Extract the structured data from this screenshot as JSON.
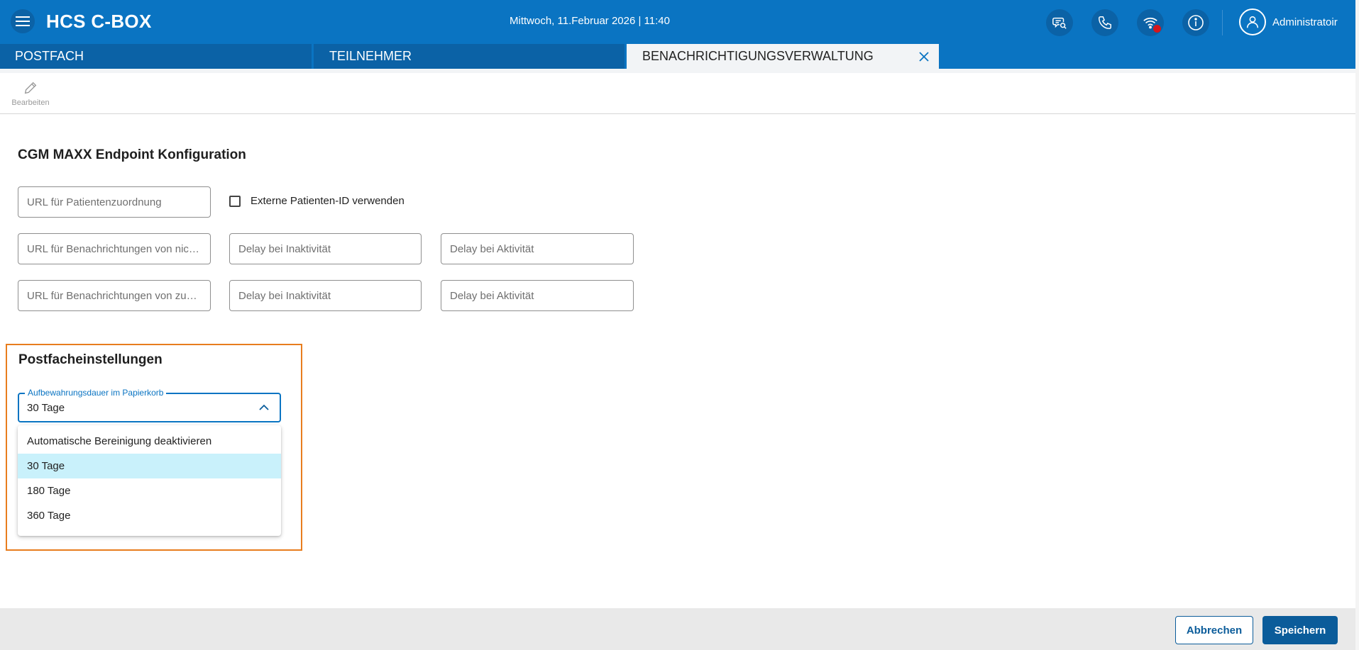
{
  "header": {
    "title": "HCS C-BOX",
    "datetime": "Mittwoch, 11.Februar 2026 | 11:40",
    "user_name": "Administratoir",
    "icons": [
      "menu-icon",
      "chat-search-icon",
      "phone-icon",
      "wifi-icon",
      "info-icon",
      "user-icon"
    ]
  },
  "tabs": [
    {
      "label": "POSTFACH"
    },
    {
      "label": "TEILNEHMER"
    },
    {
      "label": "BENACHRICHTIGUNGSVERWALTUNG",
      "active": true
    }
  ],
  "toolbar": {
    "edit_label": "Bearbeiten"
  },
  "endpoint": {
    "title": "CGM MAXX Endpoint Konfiguration",
    "url_patient_placeholder": "URL für Patientenzuordnung",
    "external_id_label": "Externe Patienten-ID verwenden",
    "row2": {
      "url_placeholder": "URL für Benachrichtungen von nic…",
      "delay_inactive_placeholder": "Delay bei Inaktivität",
      "delay_active_placeholder": "Delay bei Aktivität"
    },
    "row3": {
      "url_placeholder": "URL für Benachrichtungen von zu…",
      "delay_inactive_placeholder": "Delay bei Inaktivität",
      "delay_active_placeholder": "Delay bei Aktivität"
    }
  },
  "mailbox": {
    "title": "Postfacheinstellungen",
    "select_label": "Aufbewahrungsdauer im Papierkorb",
    "select_value": "30 Tage",
    "options": [
      "Automatische Bereinigung deaktivieren",
      "30 Tage",
      "180 Tage",
      "360 Tage"
    ],
    "selected_index": 1
  },
  "footer": {
    "cancel_label": "Abbrechen",
    "save_label": "Speichern"
  },
  "colors": {
    "primary": "#0a74c2",
    "highlight": "#e87d1e",
    "selected_option": "#c9f1fb",
    "alert_dot": "#d4161c"
  }
}
